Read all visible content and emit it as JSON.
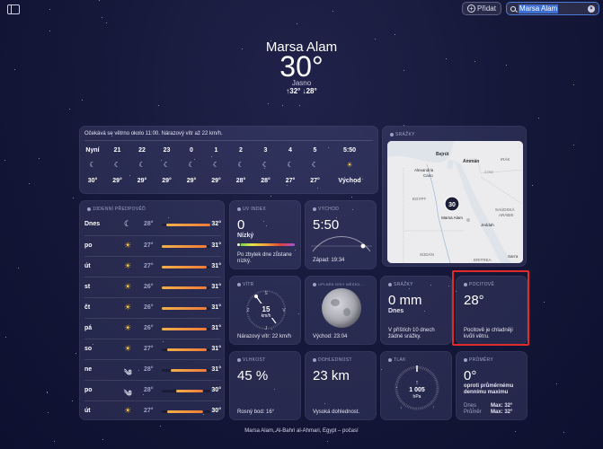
{
  "toolbar": {
    "add_label": "Přidat",
    "search_value": "Marsa Alam"
  },
  "header": {
    "city": "Marsa Alam",
    "temperature": "30°",
    "condition": "Jasno",
    "hilo": "↑32° ↓28°"
  },
  "hourly": {
    "note": "Očekává se větrno okolo 11:00. Nárazový vítr až 22 km/h.",
    "hours": [
      {
        "time": "Nyní",
        "icon": "moon-icon",
        "temp": "30°"
      },
      {
        "time": "21",
        "icon": "moon-icon",
        "temp": "29°"
      },
      {
        "time": "22",
        "icon": "moon-icon",
        "temp": "29°"
      },
      {
        "time": "23",
        "icon": "moon-icon",
        "temp": "29°"
      },
      {
        "time": "0",
        "icon": "moon-icon",
        "temp": "29°"
      },
      {
        "time": "1",
        "icon": "moon-icon",
        "temp": "29°"
      },
      {
        "time": "2",
        "icon": "moon-icon",
        "temp": "28°"
      },
      {
        "time": "3",
        "icon": "moon-icon",
        "temp": "28°"
      },
      {
        "time": "4",
        "icon": "moon-icon",
        "temp": "27°"
      },
      {
        "time": "5",
        "icon": "moon-icon",
        "temp": "27°"
      },
      {
        "time": "5:50",
        "icon": "sunrise-icon",
        "temp": "Východ"
      }
    ]
  },
  "map": {
    "title": "SRÁŽKY",
    "labels": {
      "bejrut": "Bejrút",
      "amman": "Ammán",
      "alexandria": "Alexandria",
      "cairo": "Cairo",
      "irak": "IRÁK",
      "egypt": "EGYPT",
      "saudska": "SAÚDSKÁ",
      "arabie": "ARÁBIE",
      "jeddah": "Jeddah",
      "sudan": "SÚDÁN",
      "eritrea": "ERITREA",
      "sana": "San'a",
      "marker_temp": "30",
      "marker_city": "Marsa Alam",
      "syria": "SÝRIE"
    }
  },
  "tenday": {
    "title": "10DENNÍ PŘEDPOVĚĎ",
    "days": [
      {
        "day": "Dnes",
        "icon": "moon-icon",
        "lo": "28°",
        "hi": "32°",
        "fill_start": 0.1,
        "fill_end": 1.0
      },
      {
        "day": "po",
        "icon": "sun-icon",
        "lo": "27°",
        "hi": "31°",
        "fill_start": 0.0,
        "fill_end": 0.92
      },
      {
        "day": "út",
        "icon": "sun-icon",
        "lo": "27°",
        "hi": "31°",
        "fill_start": 0.0,
        "fill_end": 0.92
      },
      {
        "day": "st",
        "icon": "sun-icon",
        "lo": "26°",
        "hi": "31°",
        "fill_start": 0.0,
        "fill_end": 0.92
      },
      {
        "day": "čt",
        "icon": "sun-icon",
        "lo": "26°",
        "hi": "31°",
        "fill_start": 0.0,
        "fill_end": 0.92
      },
      {
        "day": "pá",
        "icon": "sun-icon",
        "lo": "26°",
        "hi": "31°",
        "fill_start": 0.0,
        "fill_end": 0.92
      },
      {
        "day": "so",
        "icon": "sun-icon",
        "lo": "27°",
        "hi": "31°",
        "fill_start": 0.12,
        "fill_end": 0.92
      },
      {
        "day": "ne",
        "icon": "wind-icon",
        "lo": "28°",
        "hi": "31°",
        "fill_start": 0.18,
        "fill_end": 0.92
      },
      {
        "day": "po",
        "icon": "wind-icon",
        "lo": "28°",
        "hi": "30°",
        "fill_start": 0.3,
        "fill_end": 0.85
      },
      {
        "day": "út",
        "icon": "sun-icon",
        "lo": "27°",
        "hi": "30°",
        "fill_start": 0.12,
        "fill_end": 0.85
      }
    ]
  },
  "uv": {
    "title": "UV INDEX",
    "value": "0",
    "level": "Nízký",
    "desc": "Po zbytek dne zůstane nízký.",
    "level_fraction": 0.0
  },
  "sunrise": {
    "title": "VÝCHOD",
    "time": "5:50",
    "sunset": "Západ: 19:34"
  },
  "wind": {
    "title": "VÍTR",
    "speed": "15",
    "unit": "km/h",
    "gust": "Nárazový vítr: 22 km/h",
    "n": "S",
    "s": "J",
    "e": "V",
    "w": "Z"
  },
  "moon": {
    "title": "UPLNĚK DÍKY MĚSÍCI...",
    "rise": "Východ: 23:04"
  },
  "precip": {
    "title": "SRÁŽKY",
    "value": "0 mm",
    "when": "Dnes",
    "desc": "V příštích 10 dnech žádné srážky."
  },
  "feels": {
    "title": "POCITOVĚ",
    "value": "28°",
    "desc": "Pocitově je chladněji kvůli větru."
  },
  "humidity": {
    "title": "VLHKOST",
    "value": "45 %",
    "dew": "Rosný bod: 16°"
  },
  "visibility": {
    "title": "DOHLEDNOST",
    "value": "23 km",
    "desc": "Vysoká dohlednost."
  },
  "pressure": {
    "title": "TLAK",
    "value": "1 005",
    "unit": "hPa",
    "low": "↓",
    "high": "↑"
  },
  "averages": {
    "title": "PRŮMĚRY",
    "value": "0°",
    "desc": "oproti průměrnému dennímu maximu",
    "today_label": "Dnes",
    "today_val": "Max: 32°",
    "avg_label": "Průměr",
    "avg_val": "Max: 32°"
  },
  "footer": {
    "text": "Marsa Alam, Al-Bahri al-Ahmari, Egypt – počasí"
  },
  "colors": {
    "accent": "#3d6fd1",
    "highlight": "#e12a2a",
    "temp_bar": "#f07a3a",
    "sun": "#f6c945"
  }
}
